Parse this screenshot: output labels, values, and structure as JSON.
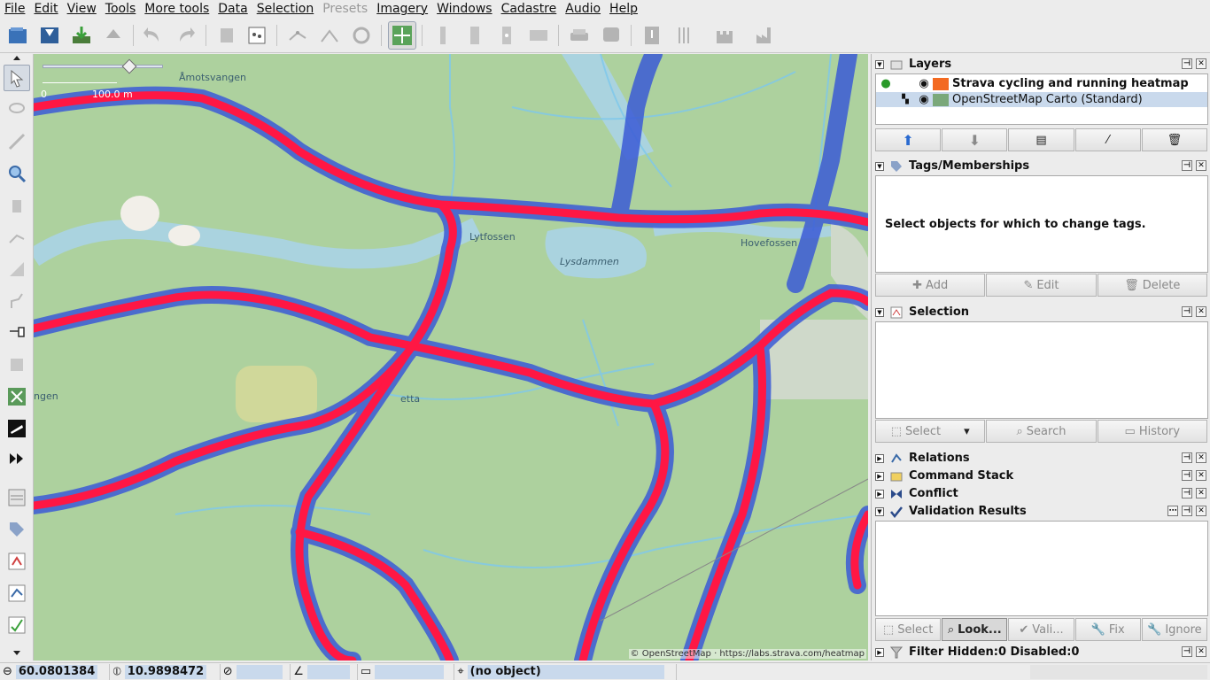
{
  "menus": [
    "File",
    "Edit",
    "View",
    "Tools",
    "More tools",
    "Data",
    "Selection",
    "Presets",
    "Imagery",
    "Windows",
    "Cadastre",
    "Audio",
    "Help"
  ],
  "map": {
    "labels": {
      "amotsvangen": "Åmotsvangen",
      "lytfossen": "Lytfossen",
      "lysdammen": "Lysdammen",
      "hovefossen": "Hovefossen",
      "vangen": "ngen",
      "etta": "etta"
    },
    "scale": {
      "zero": "0",
      "distance": "100.0 m"
    },
    "attribution": "© OpenStreetMap · https://labs.strava.com/heatmap"
  },
  "layers": {
    "title": "Layers",
    "items": [
      {
        "name": "Strava cycling and running heatmap",
        "active": true
      },
      {
        "name": "OpenStreetMap Carto (Standard)",
        "selected": true
      }
    ]
  },
  "tags": {
    "title": "Tags/Memberships",
    "empty_message": "Select objects for which to change tags.",
    "add": "Add",
    "edit": "Edit",
    "delete": "Delete"
  },
  "selection": {
    "title": "Selection",
    "select": "Select",
    "search": "Search",
    "history": "History"
  },
  "relations": {
    "title": "Relations"
  },
  "command_stack": {
    "title": "Command Stack"
  },
  "conflict": {
    "title": "Conflict"
  },
  "validation": {
    "title": "Validation Results",
    "select": "Select",
    "lookup": "Look...",
    "validate": "Vali...",
    "fix": "Fix",
    "ignore": "Ignore"
  },
  "filter": {
    "title": "Filter Hidden:0 Disabled:0"
  },
  "status": {
    "lat": "60.0801384",
    "lon": "10.9898472",
    "object": "(no object)"
  },
  "colors": {
    "map_bg": "#add19e",
    "heat_red": "#ff1744",
    "heat_blue": "#3b5bd6",
    "water": "#aad3df"
  }
}
